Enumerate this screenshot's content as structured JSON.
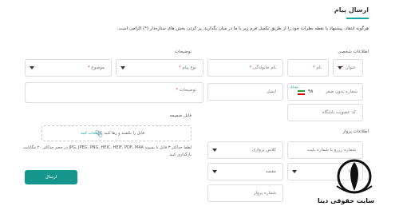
{
  "header": {
    "title": "ارسال پیام",
    "intro": "هرگونه انتقاد، پیشنهاد یا نقطه نظرات خود را از طریق تکمیل فرم زیر با ما در میان بگذارید. پر کردن بخش های ستاره‌دار (*) الزامی است."
  },
  "personal": {
    "section_label": "اطلاعات شخصی",
    "title_select": "عنوان",
    "name": "نام",
    "family": "نام خانوادگی",
    "mobile_label": "موبایل",
    "mobile_placeholder": "شماره بدون صفر",
    "country_code": "۹۸",
    "email": "ایمیل",
    "club_code": "کد عضویت باشگاه"
  },
  "message": {
    "section_label": "توضیحات",
    "type_select": "نوع پیام",
    "subject_select": "موضوع",
    "description": "توضیحات"
  },
  "attachment": {
    "section_label": "فایل ضمیمه",
    "drop_text": "فایل را بکشید و رها کنید یا",
    "choose_link": "انتخاب کنید",
    "help": "لطفا حداکثر ۳ فایل با پسوند JPG, JPEG, PNG, HEIC, HEIF, PDF, M4A در حجم حداکثر ۲۰ مگابایت بارگذاری کنید"
  },
  "flight": {
    "section_label": "اطلاعات پرواز",
    "reservation": "شماره رزرو یا شماره بلیت",
    "cabin_select": "کلاس پروازی",
    "origin_select": "مبدا",
    "destination_select": "مقصد",
    "flight_number": "شماره پرواز"
  },
  "actions": {
    "submit": "ارسال"
  },
  "watermark": {
    "text": "سایت حقوقی دینا"
  },
  "colors": {
    "accent": "#14968d",
    "required": "#e53935"
  }
}
